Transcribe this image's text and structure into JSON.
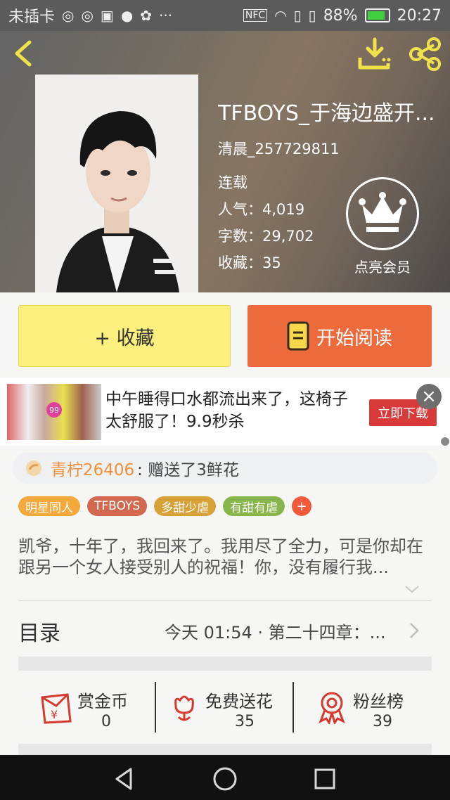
{
  "status_bar": {
    "carrier": "未插卡",
    "nfc": "NFC",
    "battery": "88%",
    "battery_level": 0.88,
    "time": "20:27"
  },
  "book": {
    "title": "TFBOYS_于海边盛开...",
    "author": "清晨_257729811",
    "status": "连载",
    "popularity_label": "人气：",
    "popularity": "4,019",
    "words_label": "字数：",
    "words": "29,702",
    "favorites_label": "收藏：",
    "favorites": "35"
  },
  "vip": {
    "label": "点亮会员"
  },
  "actions": {
    "collect_label": "+ 收藏",
    "read_label": "开始阅读"
  },
  "ad": {
    "image_badge": "99",
    "text": "中午睡得口水都流出来了，这椅子太舒服了！9.9秒杀",
    "cta": "立即下载"
  },
  "gift": {
    "user": "青柠26406",
    "message": ": 赠送了3鲜花"
  },
  "tags": [
    {
      "label": "明星同人",
      "color": "#f4a93a"
    },
    {
      "label": "TFBOYS",
      "color": "#d2694e"
    },
    {
      "label": "多甜少虐",
      "color": "#d9a238"
    },
    {
      "label": "有甜有虐",
      "color": "#86b64a"
    }
  ],
  "tag_add": "+",
  "summary": "凯爷，十年了，我回来了。我用尽了全力，可是你却在跟另一个女人接受别人的祝福！你，没有履行我...",
  "catalog": {
    "label": "目录",
    "latest": "今天 01:54 · 第二十四章：..."
  },
  "stats": [
    {
      "label": "赏金币",
      "value": "0",
      "icon": "red-envelope-icon"
    },
    {
      "label": "免费送花",
      "value": "35",
      "icon": "flower-icon"
    },
    {
      "label": "粉丝榜",
      "value": "39",
      "icon": "award-ribbon-icon"
    }
  ],
  "colors": {
    "accent_orange": "#ec6a3c",
    "collect_yellow": "#fbf07e",
    "icon_yellow": "#f2e24a",
    "icon_red": "#d6392e"
  }
}
